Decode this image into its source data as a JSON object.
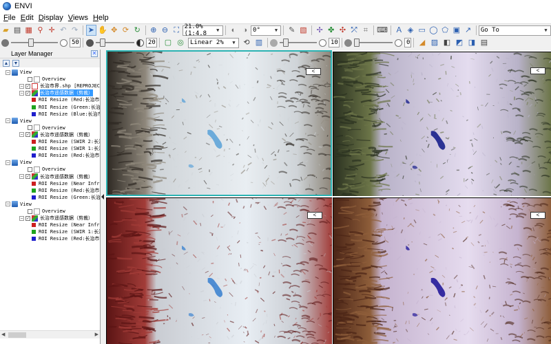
{
  "window": {
    "title": "ENVI"
  },
  "menu": [
    {
      "accel": "F",
      "rest": "ile"
    },
    {
      "accel": "E",
      "rest": "dit"
    },
    {
      "accel": "D",
      "rest": "isplay"
    },
    {
      "accel": "V",
      "rest": "iews"
    },
    {
      "accel": "H",
      "rest": "elp"
    }
  ],
  "toolbar1": {
    "zoom_value": "21.0% (1:4.8",
    "rotation_value": "0°",
    "goto_value": "Go To"
  },
  "toolbar2": {
    "brightness_value": "50",
    "contrast_value": "20",
    "stretch_value": "Linear 2%",
    "sharpen_value": "10",
    "transparency_value": "0",
    "brightness_level": 0.42,
    "contrast_level": 0.12,
    "sharpen_level": 0.1,
    "transparency_level": 0.0
  },
  "layer_manager": {
    "title": "Layer Manager",
    "items": [
      {
        "kind": "view",
        "depth": 0,
        "label": "View",
        "expanded": true
      },
      {
        "kind": "overview",
        "depth": 2,
        "label": "Overview"
      },
      {
        "kind": "vector",
        "depth": 1,
        "label": "长治市界.shp [REPROJECT",
        "checked": true,
        "expanded": true
      },
      {
        "kind": "raster",
        "depth": 1,
        "label": "长治市遥感数据（剪裁）",
        "checked": true,
        "expanded": true,
        "selected": true
      },
      {
        "kind": "band",
        "depth": 3,
        "label": "ROI Resize (Red:长治市",
        "color": "#cc1f1f"
      },
      {
        "kind": "band",
        "depth": 3,
        "label": "ROI Resize (Green:长治i",
        "color": "#1fa31f"
      },
      {
        "kind": "band",
        "depth": 3,
        "label": "ROI Resize (Blue:长治市",
        "color": "#1f1fcc"
      },
      {
        "kind": "view",
        "depth": 0,
        "label": "View",
        "expanded": true
      },
      {
        "kind": "overview",
        "depth": 2,
        "label": "Overview"
      },
      {
        "kind": "raster",
        "depth": 1,
        "label": "长治市遥感数据（剪裁）",
        "checked": true,
        "expanded": true
      },
      {
        "kind": "band",
        "depth": 3,
        "label": "ROI Resize (SWIR 2:长治",
        "color": "#cc1f1f"
      },
      {
        "kind": "band",
        "depth": 3,
        "label": "ROI Resize (SWIR 1:长治",
        "color": "#1fa31f"
      },
      {
        "kind": "band",
        "depth": 3,
        "label": "ROI Resize (Red:长治市)",
        "color": "#1f1fcc"
      },
      {
        "kind": "view",
        "depth": 0,
        "label": "View",
        "expanded": true
      },
      {
        "kind": "overview",
        "depth": 2,
        "label": "Overview"
      },
      {
        "kind": "raster",
        "depth": 1,
        "label": "长治市遥感数据（剪裁）",
        "checked": true,
        "expanded": true
      },
      {
        "kind": "band",
        "depth": 3,
        "label": "ROI Resize (Near Infrar",
        "color": "#cc1f1f"
      },
      {
        "kind": "band",
        "depth": 3,
        "label": "ROI Resize (Red:长治市)",
        "color": "#1fa31f"
      },
      {
        "kind": "band",
        "depth": 3,
        "label": "ROI Resize (Green:长治i",
        "color": "#1f1fcc"
      },
      {
        "kind": "view",
        "depth": 0,
        "label": "View",
        "expanded": true
      },
      {
        "kind": "overview",
        "depth": 2,
        "label": "Overview"
      },
      {
        "kind": "raster",
        "depth": 1,
        "label": "长治市遥感数据（剪裁）",
        "checked": true,
        "expanded": true
      },
      {
        "kind": "band",
        "depth": 3,
        "label": "ROI Resize (Near Infrar",
        "color": "#cc1f1f"
      },
      {
        "kind": "band",
        "depth": 3,
        "label": "ROI Resize (SWIR 1:长治",
        "color": "#1fa31f"
      },
      {
        "kind": "band",
        "depth": 3,
        "label": "ROI Resize (Red:长治市)",
        "color": "#1f1fcc"
      }
    ]
  },
  "views": [
    {
      "name": "true-color",
      "palette": [
        "#2f2a24",
        "#8e877b",
        "#cfd4d8",
        "#e9eef2"
      ],
      "water": "#5fa4d8"
    },
    {
      "name": "swir-composite",
      "palette": [
        "#2a3120",
        "#6c7548",
        "#b8b2c8",
        "#e4dcef"
      ],
      "water": "#18208c"
    },
    {
      "name": "nir-false-color",
      "palette": [
        "#5b1414",
        "#a23c38",
        "#c9ccd2",
        "#e8eef4"
      ],
      "water": "#3f84d0"
    },
    {
      "name": "nir-swir-composite",
      "palette": [
        "#4a2416",
        "#8e5e3a",
        "#c5b3cf",
        "#e6dcef"
      ],
      "water": "#231a9a"
    }
  ],
  "colors": {
    "active_view_border": "#2bb3b3",
    "selection": "#3399ff"
  }
}
